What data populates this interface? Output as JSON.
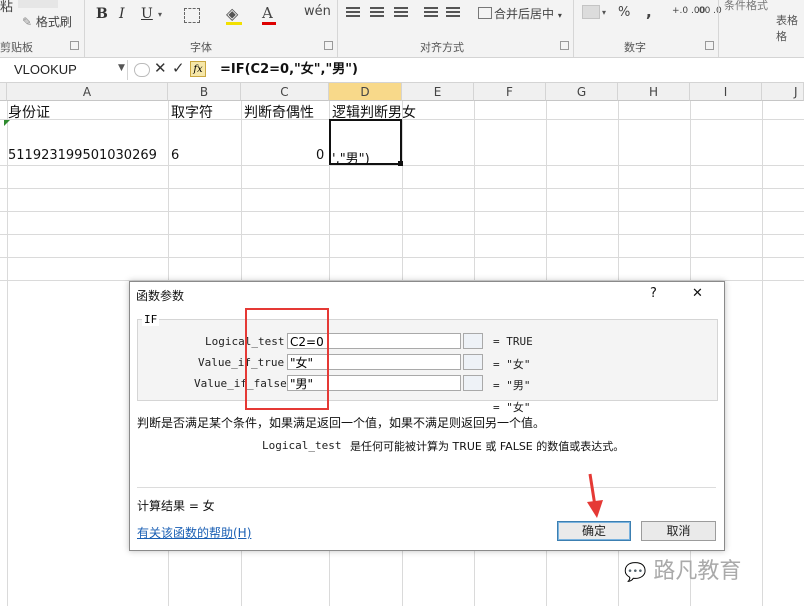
{
  "ribbon": {
    "paste_label": "粘",
    "format_painter_label": "格式刷",
    "clipboard_group": "剪贴板",
    "font_group": "字体",
    "alignment_group": "对齐方式",
    "number_group": "数字",
    "merge_center_label": "合并后居中",
    "conditional_format_label": "条件格式",
    "table_format_label": "表格格",
    "bold": "B",
    "italic": "I",
    "underline": "U",
    "percent": "%",
    "comma": ","
  },
  "formula_bar": {
    "name_box": "VLOOKUP",
    "fx_label": "fx",
    "formula": "=IF(C2=0,\"女\",\"男\")"
  },
  "columns": [
    "A",
    "B",
    "C",
    "D",
    "E",
    "F",
    "G",
    "H",
    "I",
    "J"
  ],
  "row1": {
    "a": "身份证",
    "b": "取字符",
    "c": "判断奇偶性",
    "d": "逻辑判断男女"
  },
  "row2": {
    "a": "511923199501030269",
    "b": "6",
    "c": "0",
    "d": "',\"男\")"
  },
  "dialog": {
    "title": "函数参数",
    "help_q": "?",
    "close": "✕",
    "function_name": "IF",
    "args": [
      {
        "label": "Logical_test",
        "value": "C2=0",
        "result": "= TRUE"
      },
      {
        "label": "Value_if_true",
        "value": "\"女\"",
        "result": "= \"女\""
      },
      {
        "label": "Value_if_false",
        "value": "\"男\"",
        "result": "= \"男\""
      }
    ],
    "overall_result": "= \"女\"",
    "description": "判断是否满足某个条件，如果满足返回一个值，如果不满足则返回另一个值。",
    "arg_name": "Logical_test",
    "arg_description": "是任何可能被计算为 TRUE 或 FALSE 的数值或表达式。",
    "calc_result": "计算结果 = 女",
    "help_link": "有关该函数的帮助(H)",
    "ok": "确定",
    "cancel": "取消"
  },
  "watermark": "路凡教育",
  "colors": {
    "red_annotation": "#e53935",
    "selected_header": "#f8d98a",
    "link_blue": "#1a5fb4"
  }
}
